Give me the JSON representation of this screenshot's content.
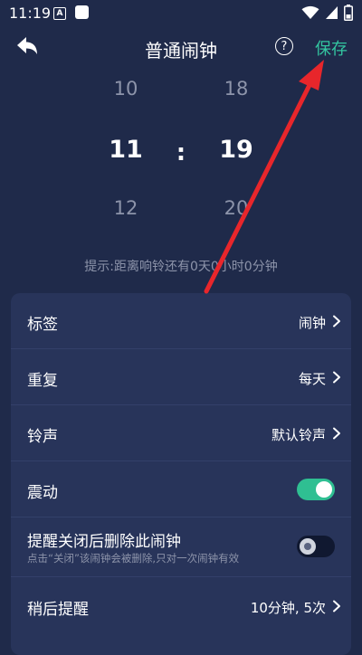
{
  "status_bar": {
    "time": "11:19",
    "notification_letter": "A"
  },
  "header": {
    "title": "普通闹钟",
    "help_label": "?",
    "save_label": "保存"
  },
  "picker": {
    "hour": {
      "prev": "10",
      "current": "11",
      "next": "12"
    },
    "separator": ":",
    "minute": {
      "prev": "18",
      "current": "19",
      "next": "20"
    }
  },
  "hint": "提示:距离响铃还有0天0小时0分钟",
  "settings": {
    "label_row": {
      "label": "标签",
      "value": "闹钟"
    },
    "repeat_row": {
      "label": "重复",
      "value": "每天"
    },
    "ringtone_row": {
      "label": "铃声",
      "value": "默认铃声"
    },
    "vibrate_row": {
      "label": "震动",
      "enabled": true
    },
    "delete_after_row": {
      "label": "提醒关闭后删除此闹钟",
      "sublabel": "点击“关闭”该闹钟会被删除,只对一次闹钟有效",
      "enabled": false
    },
    "snooze_row": {
      "label": "稍后提醒",
      "value": "10分钟, 5次"
    }
  },
  "colors": {
    "background": "#1f2a4a",
    "card": "#28345a",
    "accent": "#33c5a0",
    "toggle_on": "#2fbf92",
    "annotation_arrow": "#e8262b"
  },
  "icons": [
    "back-arrow-icon",
    "help-icon",
    "wifi-icon",
    "signal-icon",
    "battery-icon",
    "chevron-right-icon"
  ]
}
